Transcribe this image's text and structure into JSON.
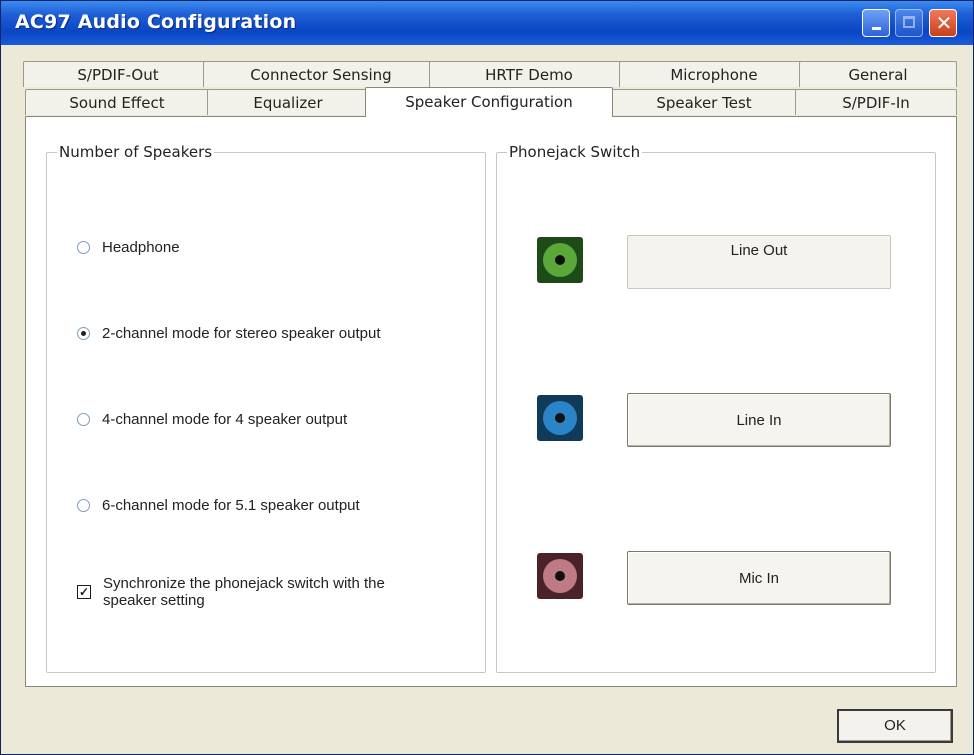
{
  "window": {
    "title": "AC97 Audio Configuration"
  },
  "tabs_row1": [
    "S/PDIF-Out",
    "Connector Sensing",
    "HRTF Demo",
    "Microphone",
    "General"
  ],
  "tabs_row2": [
    "Sound Effect",
    "Equalizer",
    "Speaker Configuration",
    "Speaker Test",
    "S/PDIF-In"
  ],
  "active_tab": "Speaker Configuration",
  "speakers": {
    "legend": "Number of Speakers",
    "options": [
      {
        "label": "Headphone",
        "selected": false
      },
      {
        "label": "2-channel mode for stereo speaker output",
        "selected": true
      },
      {
        "label": "4-channel mode for 4 speaker output",
        "selected": false
      },
      {
        "label": "6-channel mode for 5.1 speaker output",
        "selected": false
      }
    ],
    "sync": {
      "line1": "Synchronize the phonejack switch with the",
      "line2": "speaker setting",
      "checked": true,
      "mark": "✓"
    }
  },
  "phonejack": {
    "legend": "Phonejack Switch",
    "jacks": [
      {
        "icon": "green-jack-icon",
        "color": "#5aa83a",
        "label": "Line Out"
      },
      {
        "icon": "blue-jack-icon",
        "color": "#2c84c8",
        "label": "Line In"
      },
      {
        "icon": "pink-jack-icon",
        "color": "#c07a86",
        "label": "Mic In"
      }
    ]
  },
  "ok_label": "OK"
}
